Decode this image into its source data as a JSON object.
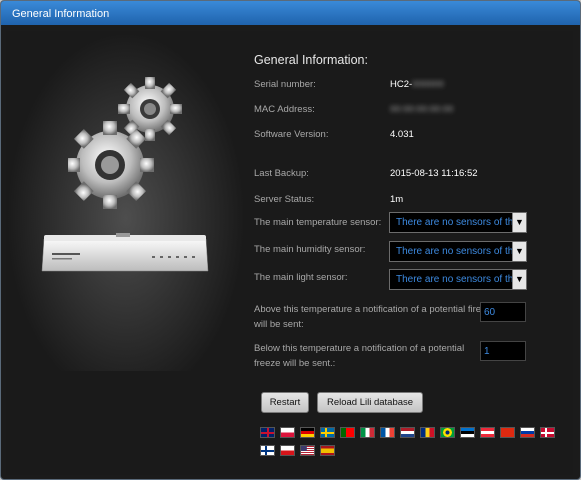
{
  "window": {
    "title": "General Information"
  },
  "info": {
    "heading": "General Information:",
    "serial_label": "Serial number:",
    "serial_value": "HC2-",
    "mac_label": "MAC Address:",
    "software_label": "Software Version:",
    "software_value": "4.031",
    "backup_label": "Last Backup:",
    "backup_value": "2015-08-13 11:16:52",
    "status_label": "Server Status:",
    "status_value": "1m",
    "temp_label": "The main temperature sensor:",
    "humidity_label": "The main humidity sensor:",
    "light_label": "The main light sensor:",
    "no_sensors": "There are no sensors of th",
    "fire_note": "Above this temperature a notification of a potential fire will be sent:",
    "fire_value": "60",
    "freeze_note": "Below this temperature a notification of a potential freeze will be sent.:",
    "freeze_value": "1"
  },
  "buttons": {
    "restart": "Restart",
    "reload": "Reload Lili database"
  },
  "flags": [
    "GB",
    "PL",
    "DE",
    "SE",
    "PT",
    "IT",
    "FR",
    "NL",
    "RO",
    "BR",
    "EE",
    "AT",
    "CN",
    "RU",
    "DK",
    "FI",
    "CZ",
    "US",
    "ES"
  ]
}
